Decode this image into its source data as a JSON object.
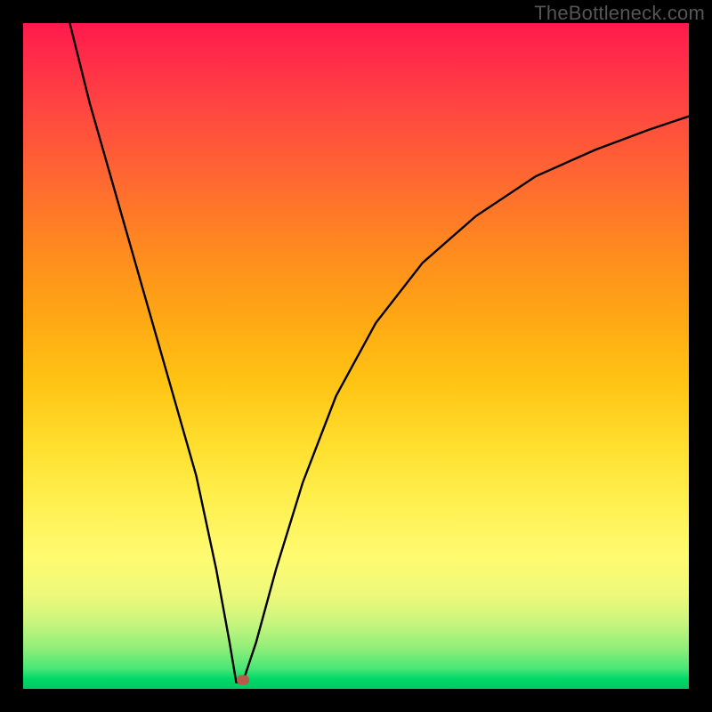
{
  "watermark": "TheBottleneck.com",
  "chart_data": {
    "type": "line",
    "title": "",
    "xlabel": "",
    "ylabel": "",
    "xlim": [
      0,
      100
    ],
    "ylim": [
      0,
      100
    ],
    "x_optimum": 32,
    "marker": {
      "x": 33,
      "y": 1.3
    },
    "series": [
      {
        "name": "bottleneck-curve",
        "x": [
          7,
          10,
          14,
          18,
          22,
          26,
          29,
          31,
          32,
          33,
          35,
          38,
          42,
          47,
          53,
          60,
          68,
          77,
          86,
          94,
          100
        ],
        "values": [
          100,
          88,
          74,
          60,
          46,
          32,
          18,
          7,
          1,
          1,
          7,
          18,
          31,
          44,
          55,
          64,
          71,
          77,
          81,
          84,
          86
        ]
      }
    ],
    "gradient_stops": [
      {
        "pos": 0,
        "color": "#ff1a4d"
      },
      {
        "pos": 24,
        "color": "#ff6a30"
      },
      {
        "pos": 54,
        "color": "#ffc414"
      },
      {
        "pos": 80,
        "color": "#fffb70"
      },
      {
        "pos": 100,
        "color": "#00c860"
      }
    ]
  }
}
